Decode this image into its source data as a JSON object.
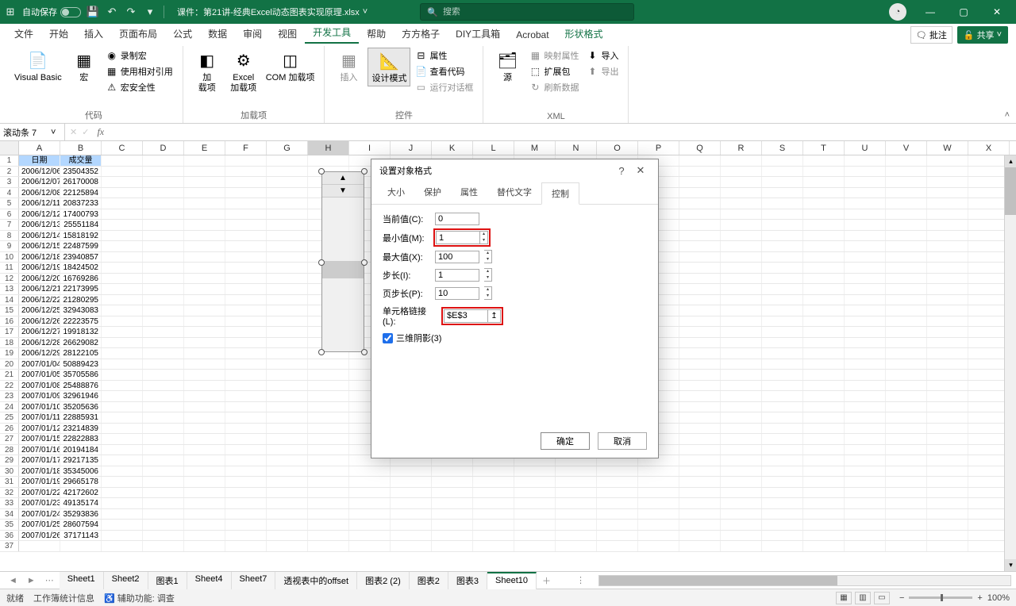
{
  "titlebar": {
    "autosave_label": "自动保存",
    "filename": "课件：第21讲-经典Excel动态图表实现原理.xlsx",
    "search_placeholder": "搜索"
  },
  "tabs": [
    "文件",
    "开始",
    "插入",
    "页面布局",
    "公式",
    "数据",
    "审阅",
    "视图",
    "开发工具",
    "帮助",
    "方方格子",
    "DIY工具箱",
    "Acrobat",
    "形状格式"
  ],
  "tab_active": "开发工具",
  "tab_green": "形状格式",
  "comments_label": "批注",
  "share_label": "共享",
  "ribbon": {
    "code": {
      "vb": "Visual Basic",
      "macro": "宏",
      "record": "录制宏",
      "relrefs": "使用相对引用",
      "security": "宏安全性",
      "group": "代码"
    },
    "addins": {
      "addins": "加\n载项",
      "excel": "Excel\n加载项",
      "com": "COM 加载项",
      "group": "加载项"
    },
    "controls": {
      "insert": "插入",
      "design": "设计模式",
      "props": "属性",
      "viewcode": "查看代码",
      "rundialog": "运行对话框",
      "group": "控件"
    },
    "xml": {
      "source": "源",
      "mapprops": "映射属性",
      "expand": "扩展包",
      "refresh": "刷新数据",
      "import": "导入",
      "export": "导出",
      "group": "XML"
    }
  },
  "namebox": "滚动条 7",
  "columns": [
    "A",
    "B",
    "C",
    "D",
    "E",
    "F",
    "G",
    "H",
    "I",
    "J",
    "K",
    "L",
    "M",
    "N",
    "O",
    "P",
    "Q",
    "R",
    "S",
    "T",
    "U",
    "V",
    "W",
    "X"
  ],
  "header_row": {
    "A": "日期",
    "B": "成交量"
  },
  "rows": [
    {
      "n": 2,
      "A": "2006/12/06",
      "B": "23504352"
    },
    {
      "n": 3,
      "A": "2006/12/07",
      "B": "26170008"
    },
    {
      "n": 4,
      "A": "2006/12/08",
      "B": "22125894"
    },
    {
      "n": 5,
      "A": "2006/12/11",
      "B": "20837233"
    },
    {
      "n": 6,
      "A": "2006/12/12",
      "B": "17400793"
    },
    {
      "n": 7,
      "A": "2006/12/13",
      "B": "25551184"
    },
    {
      "n": 8,
      "A": "2006/12/14",
      "B": "15818192"
    },
    {
      "n": 9,
      "A": "2006/12/15",
      "B": "22487599"
    },
    {
      "n": 10,
      "A": "2006/12/18",
      "B": "23940857"
    },
    {
      "n": 11,
      "A": "2006/12/19",
      "B": "18424502"
    },
    {
      "n": 12,
      "A": "2006/12/20",
      "B": "16769286"
    },
    {
      "n": 13,
      "A": "2006/12/21",
      "B": "22173995"
    },
    {
      "n": 14,
      "A": "2006/12/22",
      "B": "21280295"
    },
    {
      "n": 15,
      "A": "2006/12/25",
      "B": "32943083"
    },
    {
      "n": 16,
      "A": "2006/12/26",
      "B": "22223575"
    },
    {
      "n": 17,
      "A": "2006/12/27",
      "B": "19918132"
    },
    {
      "n": 18,
      "A": "2006/12/28",
      "B": "26629082"
    },
    {
      "n": 19,
      "A": "2006/12/29",
      "B": "28122105"
    },
    {
      "n": 20,
      "A": "2007/01/04",
      "B": "50889423"
    },
    {
      "n": 21,
      "A": "2007/01/05",
      "B": "35705586"
    },
    {
      "n": 22,
      "A": "2007/01/08",
      "B": "25488876"
    },
    {
      "n": 23,
      "A": "2007/01/09",
      "B": "32961946"
    },
    {
      "n": 24,
      "A": "2007/01/10",
      "B": "35205636"
    },
    {
      "n": 25,
      "A": "2007/01/11",
      "B": "22885931"
    },
    {
      "n": 26,
      "A": "2007/01/12",
      "B": "23214839"
    },
    {
      "n": 27,
      "A": "2007/01/15",
      "B": "22822883"
    },
    {
      "n": 28,
      "A": "2007/01/16",
      "B": "20194184"
    },
    {
      "n": 29,
      "A": "2007/01/17",
      "B": "29217135"
    },
    {
      "n": 30,
      "A": "2007/01/18",
      "B": "35345006"
    },
    {
      "n": 31,
      "A": "2007/01/19",
      "B": "29665178"
    },
    {
      "n": 32,
      "A": "2007/01/22",
      "B": "42172602"
    },
    {
      "n": 33,
      "A": "2007/01/23",
      "B": "49135174"
    },
    {
      "n": 34,
      "A": "2007/01/24",
      "B": "35293836"
    },
    {
      "n": 35,
      "A": "2007/01/25",
      "B": "28607594"
    },
    {
      "n": 36,
      "A": "2007/01/26",
      "B": "37171143"
    }
  ],
  "dialog": {
    "title": "设置对象格式",
    "tabs": [
      "大小",
      "保护",
      "属性",
      "替代文字",
      "控制"
    ],
    "tab_active": "控制",
    "current_label": "当前值(C):",
    "current_value": "0",
    "min_label": "最小值(M):",
    "min_value": "1",
    "max_label": "最大值(X):",
    "max_value": "100",
    "step_label": "步长(I):",
    "step_value": "1",
    "page_label": "页步长(P):",
    "page_value": "10",
    "link_label": "单元格链接(L):",
    "link_value": "$E$3",
    "shadow_label": "三维阴影(3)",
    "ok": "确定",
    "cancel": "取消"
  },
  "sheets": [
    "Sheet1",
    "Sheet2",
    "图表1",
    "Sheet4",
    "Sheet7",
    "透视表中的offset",
    "图表2 (2)",
    "图表2",
    "图表3",
    "Sheet10"
  ],
  "sheet_active": "Sheet10",
  "status": {
    "ready": "就绪",
    "workbook_stats": "工作簿统计信息",
    "accessibility": "辅助功能: 调查",
    "zoom": "100%"
  }
}
